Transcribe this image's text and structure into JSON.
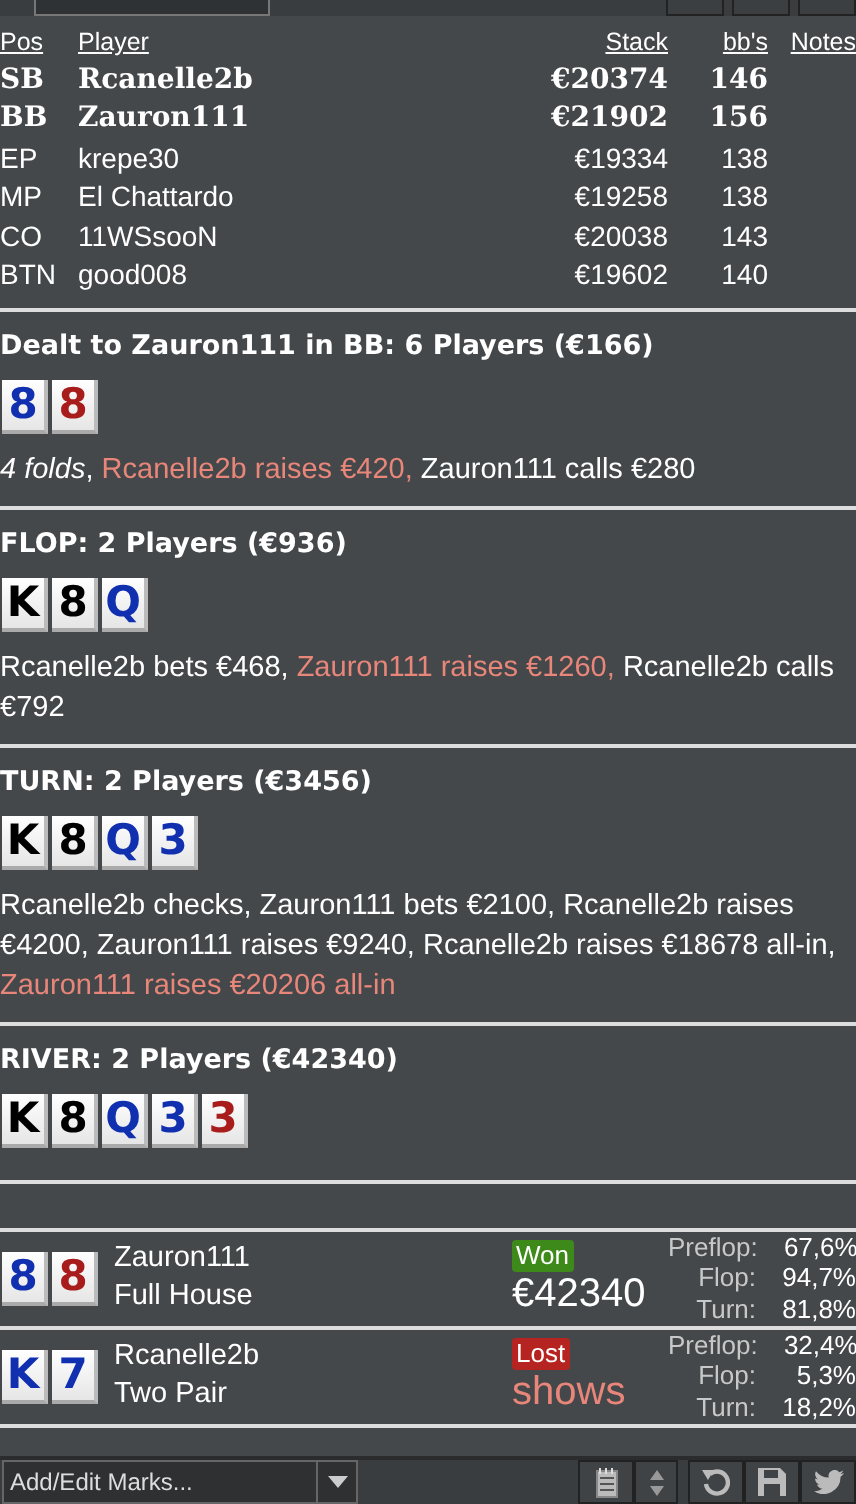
{
  "table": {
    "columns": [
      "Pos",
      "Player",
      "Stack",
      "bb's",
      "Notes"
    ],
    "rows": [
      {
        "pos": "SB",
        "player": "Rcanelle2b",
        "stack": "€20374",
        "bbs": "146",
        "highlighted": true
      },
      {
        "pos": "BB",
        "player": "Zauron111",
        "stack": "€21902",
        "bbs": "156",
        "highlighted": true
      },
      {
        "pos": "EP",
        "player": "krepe30",
        "stack": "€19334",
        "bbs": "138",
        "highlighted": false
      },
      {
        "pos": "MP",
        "player": "El Chattardo",
        "stack": "€19258",
        "bbs": "138",
        "highlighted": false
      },
      {
        "pos": "CO",
        "player": "11WSsooN",
        "stack": "€20038",
        "bbs": "143",
        "highlighted": false
      },
      {
        "pos": "BTN",
        "player": "good008",
        "stack": "€19602",
        "bbs": "140",
        "highlighted": false
      }
    ]
  },
  "streets": [
    {
      "title": "Dealt to Zauron111 in BB: 6 Players (€166)",
      "cards": [
        {
          "rank": "8",
          "color": "#1030b0"
        },
        {
          "rank": "8",
          "color": "#a81c1c"
        }
      ],
      "actions": [
        {
          "text": "*4 folds*, ",
          "kind": "normal"
        },
        {
          "text": "Rcanelle2b raises €420, ",
          "kind": "aggressive"
        },
        {
          "text": "Zauron111 calls €280",
          "kind": "normal"
        }
      ]
    },
    {
      "title": "FLOP: 2 Players (€936)",
      "cards": [
        {
          "rank": "K",
          "color": "#000000"
        },
        {
          "rank": "8",
          "color": "#000000"
        },
        {
          "rank": "Q",
          "color": "#1030b0"
        }
      ],
      "actions": [
        {
          "text": "Rcanelle2b bets €468, ",
          "kind": "normal"
        },
        {
          "text": "Zauron111 raises €1260, ",
          "kind": "aggressive"
        },
        {
          "text": "Rcanelle2b calls €792",
          "kind": "normal"
        }
      ]
    },
    {
      "title": "TURN: 2 Players (€3456)",
      "cards": [
        {
          "rank": "K",
          "color": "#000000"
        },
        {
          "rank": "8",
          "color": "#000000"
        },
        {
          "rank": "Q",
          "color": "#1030b0"
        },
        {
          "rank": "3",
          "color": "#1030b0"
        }
      ],
      "actions": [
        {
          "text": "Rcanelle2b checks, Zauron111 bets €2100, Rcanelle2b raises €4200, Zauron111 raises €9240, Rcanelle2b raises €18678 all-in, ",
          "kind": "normal"
        },
        {
          "text": "Zauron111 raises €20206 all-in",
          "kind": "aggressive"
        }
      ]
    },
    {
      "title": "RIVER: 2 Players (€42340)",
      "cards": [
        {
          "rank": "K",
          "color": "#000000"
        },
        {
          "rank": "8",
          "color": "#000000"
        },
        {
          "rank": "Q",
          "color": "#1030b0"
        },
        {
          "rank": "3",
          "color": "#1030b0"
        },
        {
          "rank": "3",
          "color": "#a81c1c"
        }
      ]
    }
  ],
  "results": [
    {
      "cards": [
        {
          "rank": "8",
          "color": "#1030b0"
        },
        {
          "rank": "8",
          "color": "#a81c1c"
        }
      ],
      "player": "Zauron111",
      "hand": "Full House",
      "badge": "Won",
      "kind": "won",
      "amount": "€42340",
      "equity": [
        {
          "label": "Preflop:",
          "value": "67,6%"
        },
        {
          "label": "Flop:",
          "value": "94,7%"
        },
        {
          "label": "Turn:",
          "value": "81,8%"
        }
      ]
    },
    {
      "cards": [
        {
          "rank": "K",
          "color": "#1030b0"
        },
        {
          "rank": "7",
          "color": "#1030b0"
        }
      ],
      "player": "Rcanelle2b",
      "hand": "Two Pair",
      "badge": "Lost",
      "kind": "lost",
      "amount": "shows",
      "equity": [
        {
          "label": "Preflop:",
          "value": "32,4%"
        },
        {
          "label": "Flop:",
          "value": "5,3%"
        },
        {
          "label": "Turn:",
          "value": "18,2%"
        }
      ]
    }
  ],
  "toolbar": {
    "marks_placeholder": "Add/Edit Marks..."
  }
}
